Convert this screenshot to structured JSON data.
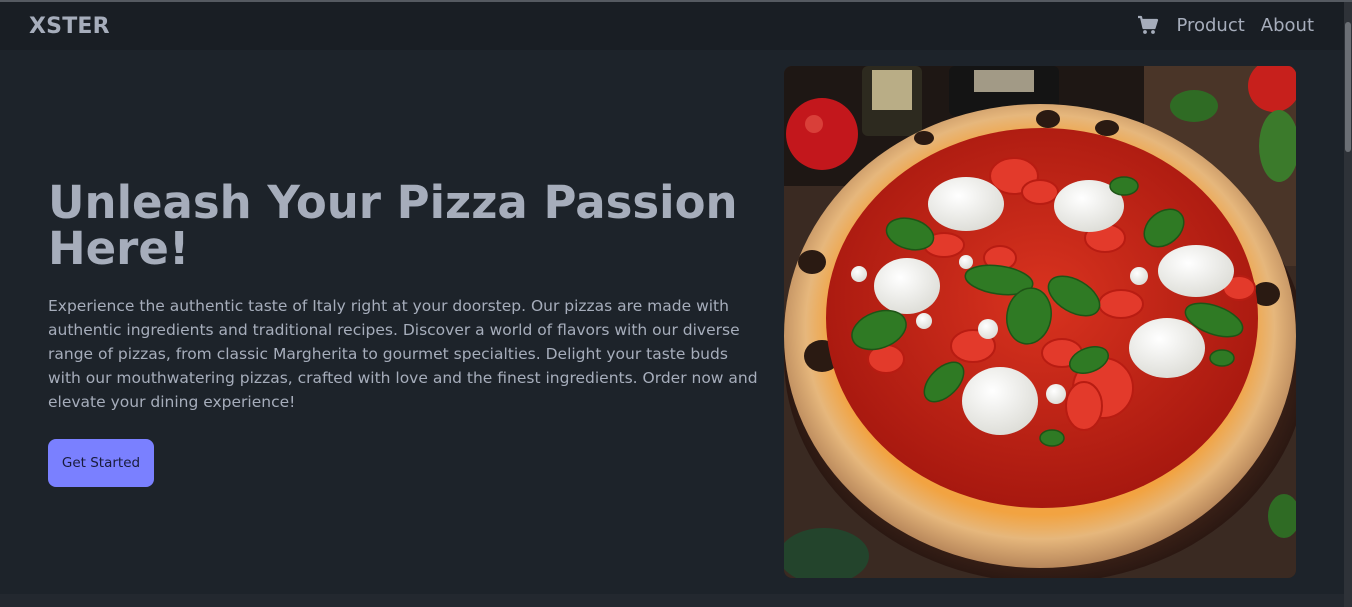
{
  "navbar": {
    "brand": "XSTER",
    "cart_icon": "shopping-cart-icon",
    "links": [
      {
        "label": "Product"
      },
      {
        "label": "About"
      }
    ]
  },
  "hero": {
    "headline": "Unleash Your Pizza Passion Here!",
    "description": "Experience the authentic taste of Italy right at your doorstep. Our pizzas are made with authentic ingredients and traditional recipes. Discover a world of flavors with our diverse range of pizzas, from classic Margherita to gourmet specialties. Delight your taste buds with our mouthwatering pizzas, crafted with love and the finest ingredients. Order now and elevate your dining experience!",
    "cta_label": "Get Started",
    "image": "margherita-pizza-photo"
  },
  "colors": {
    "background": "#1d232a",
    "navbar": "#191e24",
    "text": "#a6adbb",
    "accent": "#7a80ff"
  }
}
